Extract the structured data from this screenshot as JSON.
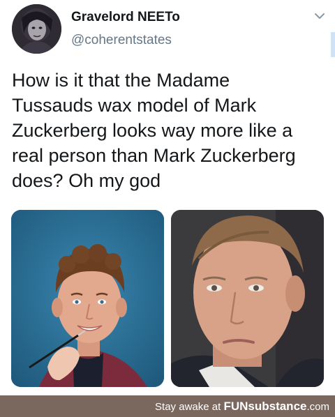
{
  "tweet": {
    "author_name": "Gravelord NEETo",
    "author_handle": "@coherentstates",
    "text": "How is it that the Madame\nTussauds wax model of Mark\nZuckerberg looks way more like a\nreal person than Mark Zuckerberg\ndoes? Oh my god"
  },
  "icons": {
    "avatar": "avatar",
    "menu": "chevron-down-icon"
  },
  "media": [
    {
      "name": "wax-figure-photo"
    },
    {
      "name": "real-person-photo"
    }
  ],
  "footer": {
    "prefix": "Stay awake at ",
    "brand_fun": "FUN",
    "brand_substance": "substance",
    "domain": ".com"
  },
  "colors": {
    "handle": "#657786",
    "footer_bg": "#7a685f",
    "left_photo_bg": "#2a6d93",
    "right_photo_bg": "#3b3a3c"
  }
}
